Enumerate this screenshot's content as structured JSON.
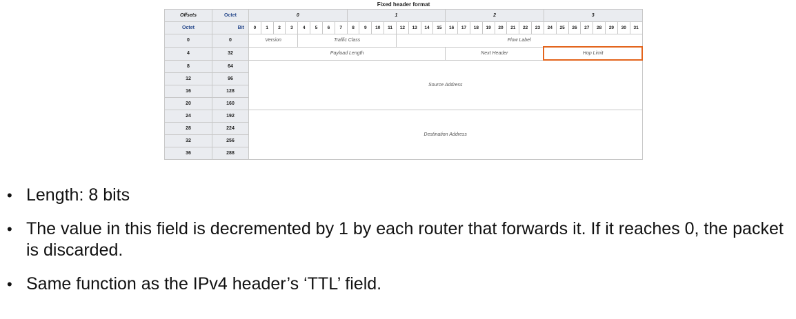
{
  "table": {
    "caption": "Fixed header format",
    "header": {
      "offsets": "Offsets",
      "octet": "Octet",
      "octet_label": "Octet",
      "bit_label": "Bit",
      "octets": [
        "0",
        "1",
        "2",
        "3"
      ],
      "bits": [
        "0",
        "1",
        "2",
        "3",
        "4",
        "5",
        "6",
        "7",
        "8",
        "9",
        "10",
        "11",
        "12",
        "13",
        "14",
        "15",
        "16",
        "17",
        "18",
        "19",
        "20",
        "21",
        "22",
        "23",
        "24",
        "25",
        "26",
        "27",
        "28",
        "29",
        "30",
        "31"
      ]
    },
    "rows": [
      {
        "octet": "0",
        "bit": "0"
      },
      {
        "octet": "4",
        "bit": "32"
      },
      {
        "octet": "8",
        "bit": "64"
      },
      {
        "octet": "12",
        "bit": "96"
      },
      {
        "octet": "16",
        "bit": "128"
      },
      {
        "octet": "20",
        "bit": "160"
      },
      {
        "octet": "24",
        "bit": "192"
      },
      {
        "octet": "28",
        "bit": "224"
      },
      {
        "octet": "32",
        "bit": "256"
      },
      {
        "octet": "36",
        "bit": "288"
      }
    ],
    "fields": {
      "version": "Version",
      "traffic_class": "Traffic Class",
      "flow_label": "Flow Label",
      "payload_length": "Payload Length",
      "next_header": "Next Header",
      "hop_limit": "Hop Limit",
      "source_address": "Source Address",
      "destination_address": "Destination Address"
    },
    "highlight_color": "#e3641c"
  },
  "bullets": [
    "Length: 8 bits",
    "The value in this field is decremented by 1 by each router that forwards it.  If it reaches 0, the packet is discarded.",
    "Same function as the IPv4 header’s ‘TTL’ field."
  ]
}
